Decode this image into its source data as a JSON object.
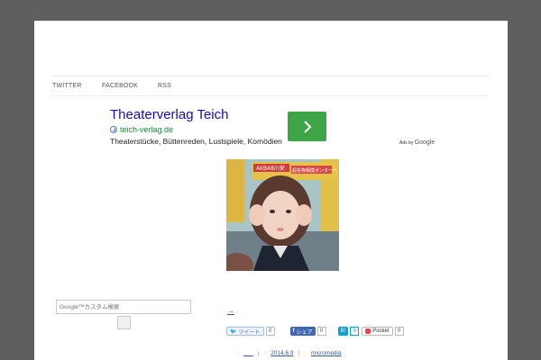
{
  "nav": {
    "items": [
      {
        "label": "TWITTER"
      },
      {
        "label": "FACEBOOK"
      },
      {
        "label": "RSS"
      }
    ]
  },
  "ad": {
    "title": "Theaterverlag Teich",
    "url": "teich-verlag.de",
    "description": "Theaterstücke, Büttenreden, Lustspiele, Komödien",
    "ads_by_prefix": "Ads by",
    "ads_by_brand": "Google",
    "button_color": "#3da546"
  },
  "photo": {
    "overlay_text": "AKB48川栄",
    "overlay_text2": "超名物相撲ボンターヘ"
  },
  "search": {
    "placeholder": "Google™カスタム検索"
  },
  "post": {
    "arrow_link": "→"
  },
  "social": {
    "twitter_label": "ツイート",
    "twitter_count": "0",
    "facebook_label": "シェア",
    "facebook_count": "0",
    "hatena_label": "B!",
    "hatena_count": "0",
    "pocket_label": "Pocket",
    "pocket_count": "0"
  },
  "meta": {
    "category": "___",
    "date": "2014.6.9",
    "author": "micromedia"
  }
}
